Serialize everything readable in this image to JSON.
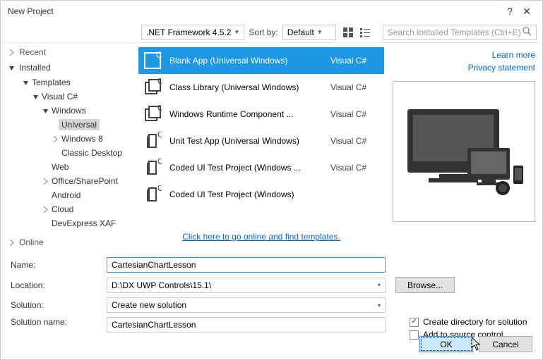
{
  "window": {
    "title": "New Project"
  },
  "toolbar": {
    "framework": ".NET Framework 4.5.2",
    "sortby_label": "Sort by:",
    "sortby_value": "Default",
    "search_placeholder": "Search Installed Templates (Ctrl+E)"
  },
  "tree": {
    "recent": "Recent",
    "installed": "Installed",
    "online": "Online",
    "templates": "Templates",
    "visualcs": "Visual C#",
    "windows": "Windows",
    "universal": "Universal",
    "windows8": "Windows 8",
    "classicdesktop": "Classic Desktop",
    "web": "Web",
    "officesp": "Office/SharePoint",
    "android": "Android",
    "cloud": "Cloud",
    "devexpress": "DevExpress XAF"
  },
  "templates": [
    {
      "name": "Blank App (Universal Windows)",
      "lang": "Visual C#",
      "selected": true
    },
    {
      "name": "Class Library (Universal Windows)",
      "lang": "Visual C#",
      "selected": false
    },
    {
      "name": "Windows Runtime Component ...",
      "lang": "Visual C#",
      "selected": false
    },
    {
      "name": "Unit Test App (Universal Windows)",
      "lang": "Visual C#",
      "selected": false
    },
    {
      "name": "Coded UI Test Project (Windows ...",
      "lang": "Visual C#",
      "selected": false
    },
    {
      "name": "Coded UI Test Project (Windows)",
      "lang": "",
      "selected": false
    }
  ],
  "online_link": "Click here to go online and find templates.",
  "preview": {
    "learn_more": "Learn more",
    "privacy": "Privacy statement"
  },
  "form": {
    "name_label": "Name:",
    "name_value": "CartesianChartLesson",
    "location_label": "Location:",
    "location_value": "D:\\DX UWP Controls\\15.1\\",
    "solution_label": "Solution:",
    "solution_value": "Create new solution",
    "solname_label": "Solution name:",
    "solname_value": "CartesianChartLesson",
    "browse": "Browse...",
    "createdir": "Create directory for solution",
    "addsrc": "Add to source control"
  },
  "buttons": {
    "ok": "OK",
    "cancel": "Cancel"
  }
}
